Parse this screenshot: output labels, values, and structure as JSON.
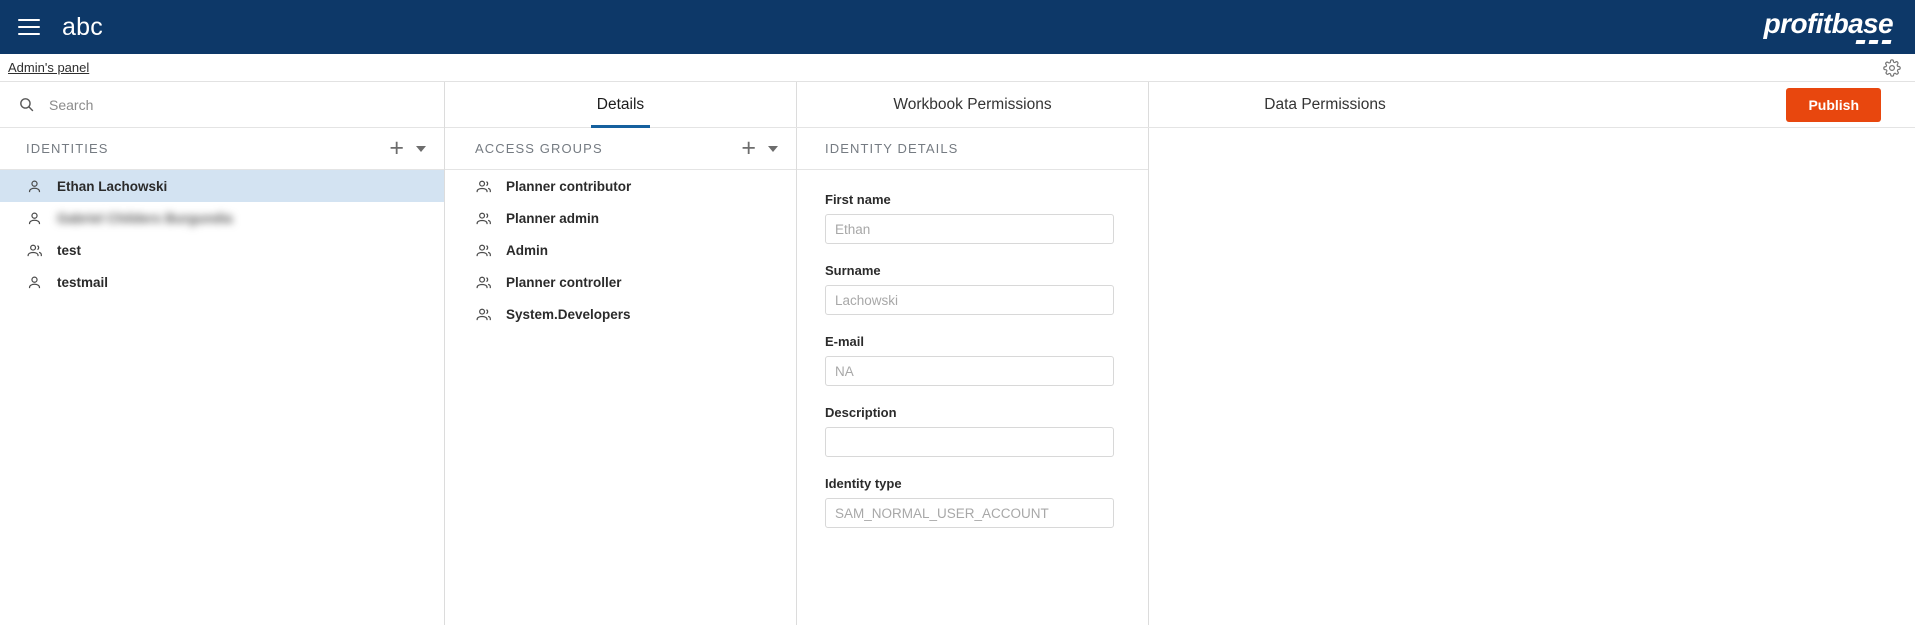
{
  "header": {
    "menu_icon": "hamburger-icon",
    "app_title": "abc",
    "logo_text": "profitbase"
  },
  "breadcrumb": {
    "link_label": "Admin's panel",
    "settings_icon": "gear-icon"
  },
  "tabs": [
    {
      "label": "Details",
      "active": true
    },
    {
      "label": "Workbook Permissions",
      "active": false
    },
    {
      "label": "Data Permissions",
      "active": false
    }
  ],
  "toolbar": {
    "publish_label": "Publish",
    "publish_color": "#E8470E"
  },
  "search": {
    "placeholder": "Search",
    "value": "",
    "icon": "search-icon"
  },
  "identities": {
    "title": "IDENTITIES",
    "add_icon": "plus-icon",
    "dropdown_icon": "chevron-down-icon",
    "items": [
      {
        "label": "Ethan Lachowski",
        "icon": "user-icon",
        "selected": true,
        "blurred": false
      },
      {
        "label": "Gabriel Childers Burgundia",
        "icon": "user-icon",
        "selected": false,
        "blurred": true
      },
      {
        "label": "test",
        "icon": "group-icon",
        "selected": false,
        "blurred": false
      },
      {
        "label": "testmail",
        "icon": "user-icon",
        "selected": false,
        "blurred": false
      }
    ]
  },
  "access_groups": {
    "title": "ACCESS GROUPS",
    "add_icon": "plus-icon",
    "dropdown_icon": "chevron-down-icon",
    "items": [
      {
        "label": "Planner contributor",
        "icon": "group-icon"
      },
      {
        "label": "Planner admin",
        "icon": "group-icon"
      },
      {
        "label": "Admin",
        "icon": "group-icon"
      },
      {
        "label": "Planner controller",
        "icon": "group-icon"
      },
      {
        "label": "System.Developers",
        "icon": "group-icon"
      }
    ]
  },
  "identity_details": {
    "title": "IDENTITY DETAILS",
    "fields": [
      {
        "label": "First name",
        "value": "",
        "placeholder": "Ethan"
      },
      {
        "label": "Surname",
        "value": "",
        "placeholder": "Lachowski"
      },
      {
        "label": "E-mail",
        "value": "",
        "placeholder": "NA"
      },
      {
        "label": "Description",
        "value": "",
        "placeholder": ""
      },
      {
        "label": "Identity type",
        "value": "",
        "placeholder": "SAM_NORMAL_USER_ACCOUNT"
      }
    ]
  },
  "colors": {
    "header_blue": "#0D3868",
    "selection_blue": "#D3E3F2",
    "tab_underline": "#15609E",
    "accent_orange": "#E8470E"
  }
}
